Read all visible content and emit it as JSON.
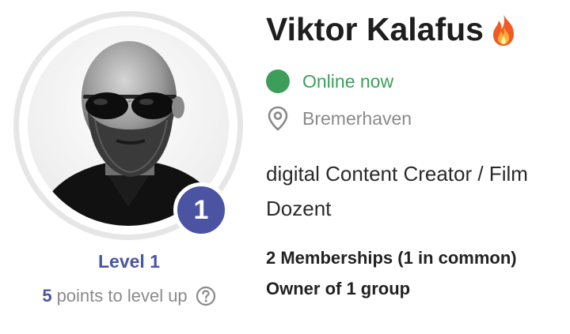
{
  "profile": {
    "name": "Viktor Kalafus",
    "name_icon": "fire-icon",
    "avatar_icon": "profile-photo",
    "level_badge": "1",
    "level_label": "Level 1",
    "points_value": "5",
    "points_text": "points to level up",
    "help_icon": "question-circle-icon"
  },
  "status": {
    "text": "Online now",
    "color": "#3d9e5a"
  },
  "location": {
    "icon": "map-pin-icon",
    "text": "Bremerhaven"
  },
  "bio": {
    "line1": "digital Content Creator / Film",
    "line2": "Dozent"
  },
  "groups": {
    "memberships": "2 Memberships (1 in common)",
    "owner": "Owner of 1 group"
  },
  "colors": {
    "accent": "#4a54a3",
    "online": "#3d9e5a",
    "muted": "#8a8a8a",
    "ring": "#e6e6e6"
  }
}
